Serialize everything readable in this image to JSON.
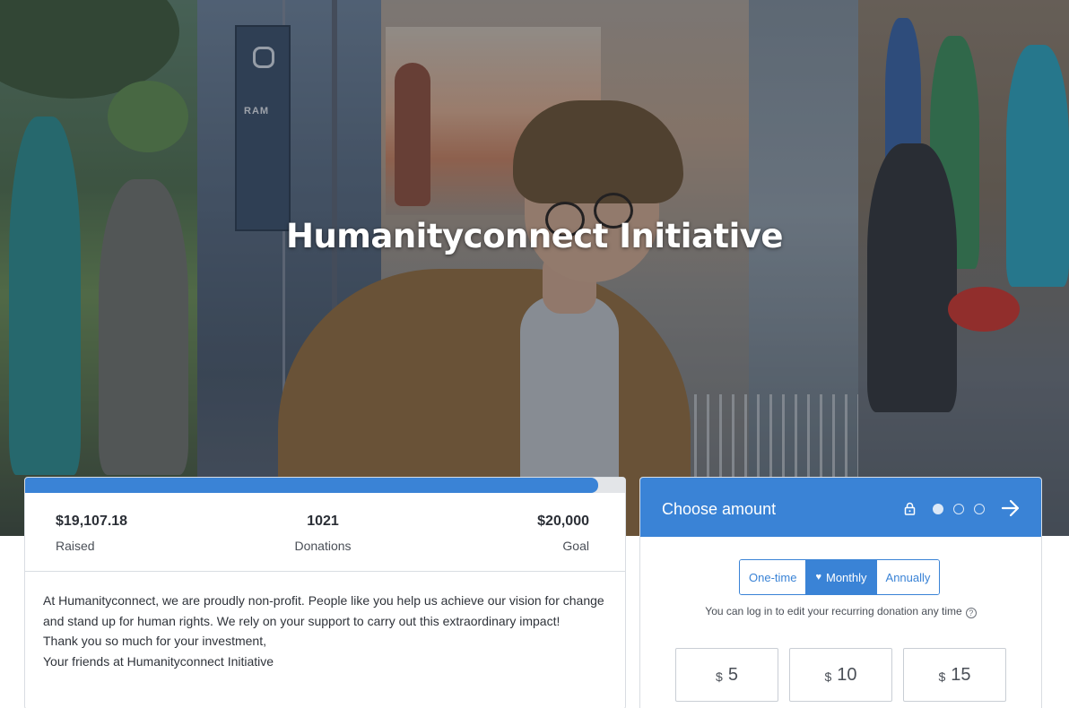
{
  "hero": {
    "title": "Humanityconnect Initiative",
    "banner_text": "RAM"
  },
  "campaign": {
    "progress_fraction": 0.9554,
    "raised_value": "$19,107.18",
    "raised_label": "Raised",
    "donations_value": "1021",
    "donations_label": "Donations",
    "goal_value": "$20,000",
    "goal_label": "Goal",
    "description": [
      "At Humanityconnect, we are proudly non-profit. People like you help us achieve our vision for change and stand up for human rights. We rely on your support to carry out this extraordinary impact!",
      "Thank you so much for your investment,",
      "Your friends at Humanityconnect Initiative"
    ]
  },
  "donation": {
    "title": "Choose amount",
    "steps_total": 3,
    "step_current": 1,
    "frequency_options": [
      {
        "label": "One-time",
        "selected": false
      },
      {
        "label": "Monthly",
        "selected": true,
        "icon": "heart-icon"
      },
      {
        "label": "Annually",
        "selected": false
      }
    ],
    "recurring_note": "You can log in to edit your recurring donation any time",
    "currency_symbol": "$",
    "amounts": [
      "5",
      "10",
      "15"
    ]
  },
  "colors": {
    "accent": "#3a83d6",
    "progress_track": "#e3e5e8",
    "text_dark": "#2b2f36"
  }
}
